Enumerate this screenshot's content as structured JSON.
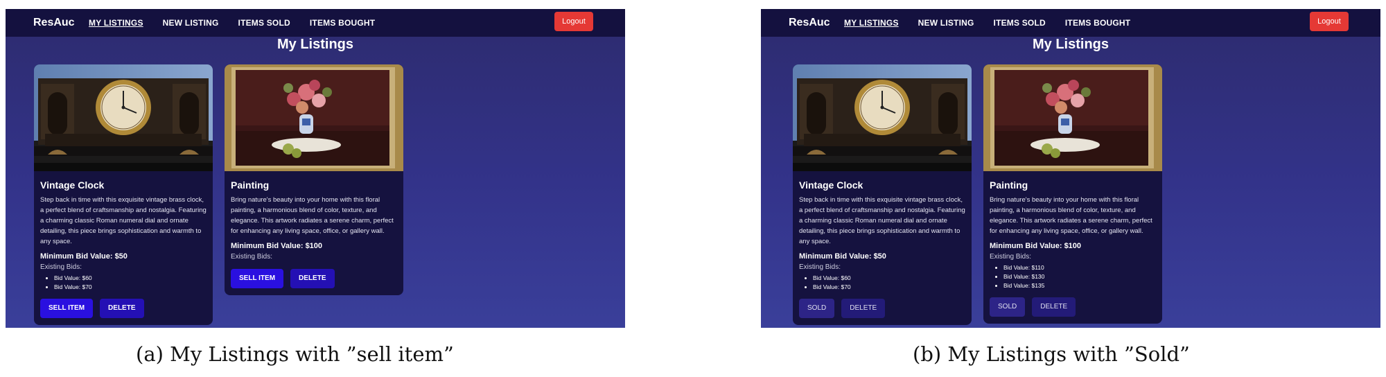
{
  "panels": [
    {
      "brand": "ResAuc",
      "nav": [
        "MY LISTINGS",
        "NEW LISTING",
        "ITEMS SOLD",
        "ITEMS BOUGHT"
      ],
      "logout_label": "Logout",
      "page_title": "My Listings",
      "cards": [
        {
          "title": "Vintage Clock",
          "description": "Step back in time with this exquisite vintage brass clock, a perfect blend of craftsmanship and nostalgia. Featuring a charming classic Roman numeral dial and ornate detailing, this piece brings sophistication and warmth to any space.",
          "min_bid": "Minimum Bid Value: $50",
          "existing_label": "Existing Bids:",
          "bids": [
            "Bid Value: $60",
            "Bid Value: $70"
          ],
          "primary_button": "SELL ITEM",
          "delete_button": "DELETE"
        },
        {
          "title": "Painting",
          "description": "Bring nature's beauty into your home with this floral painting, a harmonious blend of color, texture, and elegance. This artwork radiates a serene charm, perfect for enhancing any living space, office, or gallery wall.",
          "min_bid": "Minimum Bid Value: $100",
          "existing_label": "Existing Bids:",
          "bids": [],
          "primary_button": "SELL ITEM",
          "delete_button": "DELETE"
        }
      ]
    },
    {
      "brand": "ResAuc",
      "nav": [
        "MY LISTINGS",
        "NEW LISTING",
        "ITEMS SOLD",
        "ITEMS BOUGHT"
      ],
      "logout_label": "Logout",
      "page_title": "My Listings",
      "cards": [
        {
          "title": "Vintage Clock",
          "description": "Step back in time with this exquisite vintage brass clock, a perfect blend of craftsmanship and nostalgia. Featuring a charming classic Roman numeral dial and ornate detailing, this piece brings sophistication and warmth to any space.",
          "min_bid": "Minimum Bid Value: $50",
          "existing_label": "Existing Bids:",
          "bids": [
            "Bid Value: $60",
            "Bid Value: $70"
          ],
          "primary_button": "SOLD",
          "delete_button": "DELETE"
        },
        {
          "title": "Painting",
          "description": "Bring nature's beauty into your home with this floral painting, a harmonious blend of color, texture, and elegance. This artwork radiates a serene charm, perfect for enhancing any living space, office, or gallery wall.",
          "min_bid": "Minimum Bid Value: $100",
          "existing_label": "Existing Bids:",
          "bids": [
            "Bid Value: $110",
            "Bid Value: $130",
            "Bid Value: $135"
          ],
          "primary_button": "SOLD",
          "delete_button": "DELETE"
        }
      ]
    }
  ],
  "captions": [
    "(a) My Listings with ”sell item”",
    "(b) My Listings with ”Sold”"
  ],
  "colors": {
    "navbar": "#14113f",
    "logout": "#e53935",
    "sell_button": "#2a10e0",
    "card": "#15123f"
  },
  "icons": [
    "clock-image",
    "painting-image"
  ]
}
